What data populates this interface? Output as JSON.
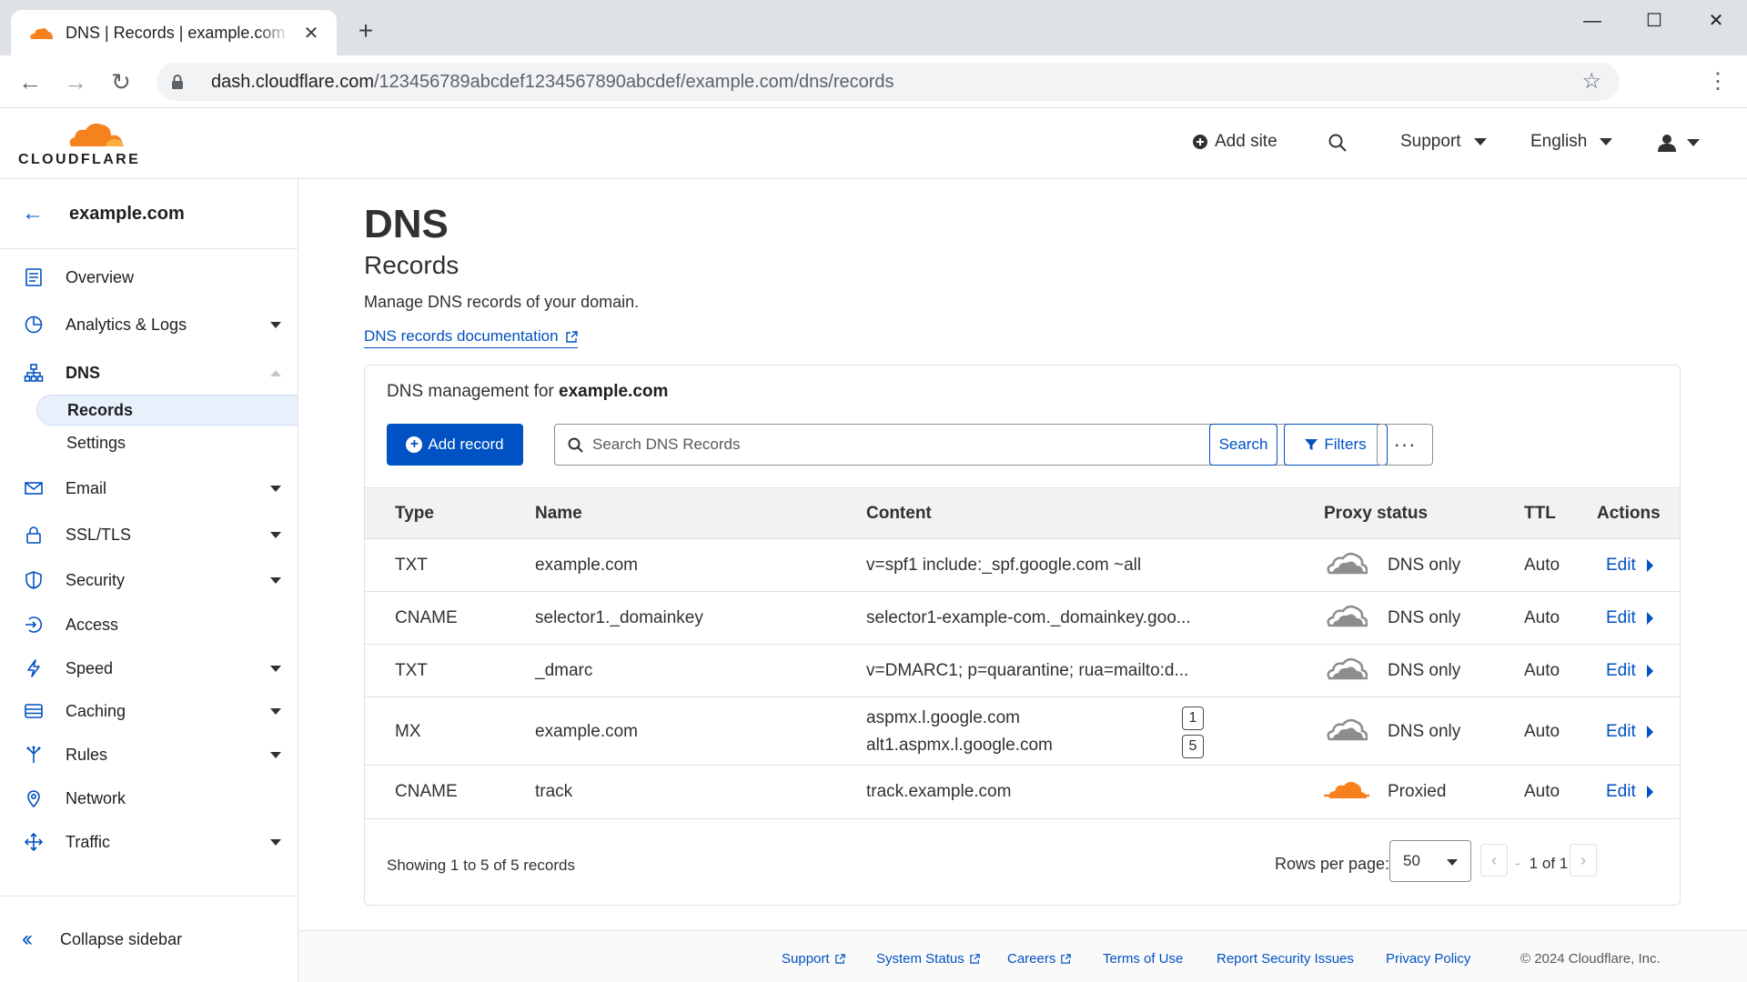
{
  "browser": {
    "tab_title": "DNS | Records | example.com | Cloudflare",
    "url_host": "dash.cloudflare.com",
    "url_path": "/123456789abcdef1234567890abcdef/example.com/dns/records"
  },
  "header": {
    "logo_text": "CLOUDFLARE",
    "add_site": "Add site",
    "support": "Support",
    "language": "English"
  },
  "sidebar": {
    "domain": "example.com",
    "items": [
      {
        "label": "Overview"
      },
      {
        "label": "Analytics & Logs"
      },
      {
        "label": "DNS"
      },
      {
        "label": "Records"
      },
      {
        "label": "Settings"
      },
      {
        "label": "Email"
      },
      {
        "label": "SSL/TLS"
      },
      {
        "label": "Security"
      },
      {
        "label": "Access"
      },
      {
        "label": "Speed"
      },
      {
        "label": "Caching"
      },
      {
        "label": "Rules"
      },
      {
        "label": "Network"
      },
      {
        "label": "Traffic"
      }
    ],
    "collapse": "Collapse sidebar"
  },
  "page": {
    "title": "DNS",
    "subtitle": "Records",
    "description": "Manage DNS records of your domain.",
    "doc_link": "DNS records documentation"
  },
  "card": {
    "title_prefix": "DNS management for",
    "title_domain": "example.com",
    "add_record": "Add record",
    "search_placeholder": "Search DNS Records",
    "search_button": "Search",
    "filters_button": "Filters",
    "more_button": "···"
  },
  "table": {
    "headers": {
      "type": "Type",
      "name": "Name",
      "content": "Content",
      "proxy": "Proxy status",
      "ttl": "TTL",
      "actions": "Actions"
    },
    "rows": [
      {
        "type": "TXT",
        "name": "example.com",
        "content": "v=spf1 include:_spf.google.com ~all",
        "proxy": "DNS only",
        "ttl": "Auto",
        "action": "Edit"
      },
      {
        "type": "CNAME",
        "name": "selector1._domainkey",
        "content": "selector1-example-com._domainkey.goo...",
        "proxy": "DNS only",
        "ttl": "Auto",
        "action": "Edit"
      },
      {
        "type": "TXT",
        "name": "_dmarc",
        "content": "v=DMARC1; p=quarantine; rua=mailto:d...",
        "proxy": "DNS only",
        "ttl": "Auto",
        "action": "Edit"
      },
      {
        "type": "MX",
        "name": "example.com",
        "content": "aspmx.l.google.com",
        "content2": "alt1.aspmx.l.google.com",
        "priority1": "1",
        "priority2": "5",
        "proxy": "DNS only",
        "ttl": "Auto",
        "action": "Edit"
      },
      {
        "type": "CNAME",
        "name": "track",
        "content": "track.example.com",
        "proxy": "Proxied",
        "ttl": "Auto",
        "action": "Edit"
      }
    ]
  },
  "pagination": {
    "showing": "Showing 1 to 5 of 5 records",
    "rows_per_page_label": "Rows per page:",
    "rows_per_page": "50",
    "page_current": "1",
    "page_of": "of 1"
  },
  "footer": {
    "support": "Support",
    "system_status": "System Status",
    "careers": "Careers",
    "terms": "Terms of Use",
    "report": "Report Security Issues",
    "privacy": "Privacy Policy",
    "copyright": "© 2024 Cloudflare, Inc."
  },
  "colors": {
    "accent": "#0051c3",
    "brand_orange": "#f6821f",
    "dns_only_cloud": "#8d8d8d"
  }
}
